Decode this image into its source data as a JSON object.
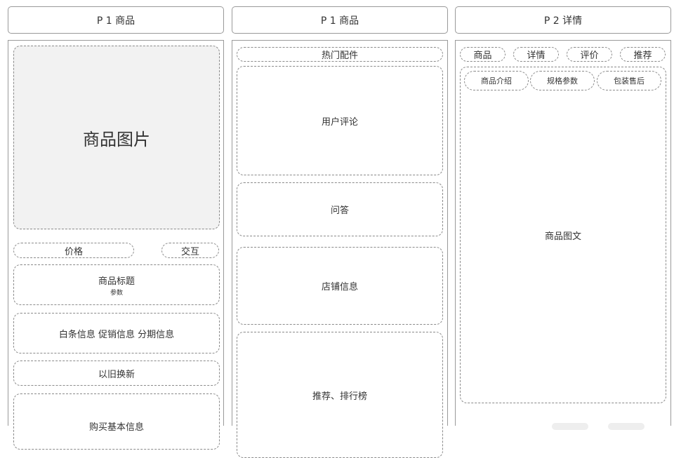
{
  "columns": [
    {
      "header": "P 1 商品",
      "image_label": "商品图片",
      "price_label": "价格",
      "interact_label": "交互",
      "title_label": "商品标题",
      "params_label": "参数",
      "promo_label": "白条信息 促销信息 分期信息",
      "tradein_label": "以旧换新",
      "purchase_label": "购买基本信息"
    },
    {
      "header": "P 1 商品",
      "accessories_label": "热门配件",
      "reviews_label": "用户评论",
      "qa_label": "问答",
      "shop_label": "店铺信息",
      "ranking_label": "推荐、排行榜"
    },
    {
      "header": "P 2 详情",
      "tabs": [
        "商品",
        "详情",
        "评价",
        "推荐"
      ],
      "subtabs": [
        "商品介绍",
        "规格参数",
        "包装售后"
      ],
      "content_label": "商品图文"
    }
  ]
}
